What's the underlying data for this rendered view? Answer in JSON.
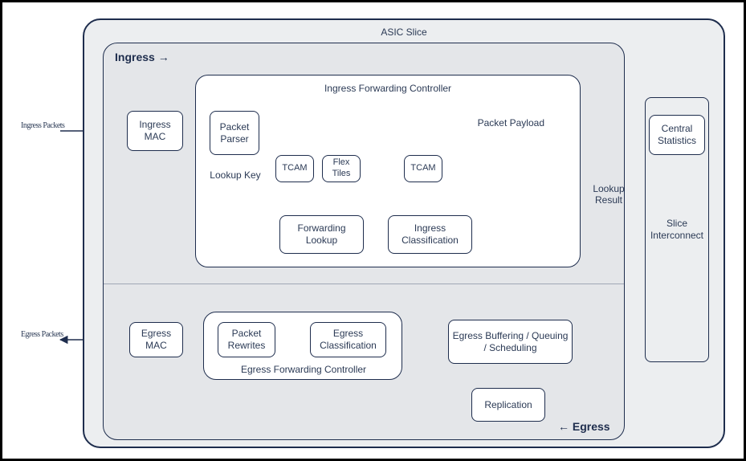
{
  "outer_text": {
    "ingress_packets": "Ingress Packets",
    "egress_packets": "Egress Packets"
  },
  "containers": {
    "asic_slice": "ASIC Slice",
    "ingress_section": "Ingress →",
    "egress_section": "← Egress",
    "ifc": "Ingress Forwarding Controller",
    "efc": "Egress Forwarding Controller"
  },
  "nodes": {
    "ingress_mac": "Ingress MAC",
    "packet_parser": "Packet Parser",
    "tcam1": "TCAM",
    "flex_tiles": "Flex Tiles",
    "tcam2": "TCAM",
    "forwarding_lookup": "Forwarding Lookup",
    "ingress_classification": "Ingress Classification",
    "central_stats": "Central Statistics",
    "slice_interconnect": "Slice Interconnect",
    "egress_buffering": "Egress Buffering / Queuing / Scheduling",
    "replication": "Replication",
    "egress_classification": "Egress Classification",
    "packet_rewrites": "Packet Rewrites",
    "egress_mac": "Egress MAC"
  },
  "labels": {
    "packet_payload": "Packet Payload",
    "lookup_key": "Lookup Key",
    "lookup_result": "Lookup Result"
  }
}
